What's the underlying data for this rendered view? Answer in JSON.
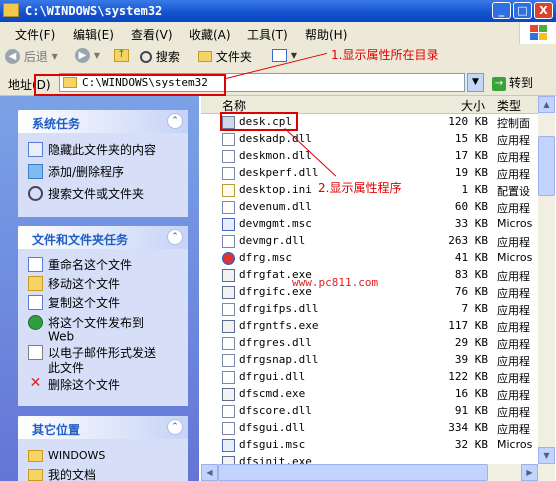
{
  "window": {
    "title": "C:\\WINDOWS\\system32",
    "min": "_",
    "max": "□",
    "close": "X"
  },
  "menu": [
    {
      "label": "文件(F)"
    },
    {
      "label": "编辑(E)"
    },
    {
      "label": "查看(V)"
    },
    {
      "label": "收藏(A)"
    },
    {
      "label": "工具(T)"
    },
    {
      "label": "帮助(H)"
    }
  ],
  "toolbar": {
    "back": "后退",
    "forward": "",
    "search": "搜索",
    "folders": "文件夹"
  },
  "address": {
    "label": "地址(D)",
    "value": "C:\\WINDOWS\\system32",
    "go": "转到"
  },
  "tasks": {
    "system": {
      "title": "系统任务",
      "items": [
        "隐藏此文件夹的内容",
        "添加/删除程序",
        "搜索文件或文件夹"
      ]
    },
    "file": {
      "title": "文件和文件夹任务",
      "items": [
        "重命名这个文件",
        "移动这个文件",
        "复制这个文件",
        "将这个文件发布到",
        "Web",
        "以电子邮件形式发送",
        "此文件",
        "删除这个文件"
      ]
    },
    "other": {
      "title": "其它位置",
      "items": [
        "WINDOWS",
        "我的文档"
      ]
    }
  },
  "columns": {
    "name": "名称",
    "size": "大小",
    "type": "类型"
  },
  "files": [
    {
      "name": "desk.cpl",
      "size": "120 KB",
      "type": "控制面",
      "icon": "cpl-icon"
    },
    {
      "name": "deskadp.dll",
      "size": "15 KB",
      "type": "应用程",
      "icon": "dll-icon"
    },
    {
      "name": "deskmon.dll",
      "size": "17 KB",
      "type": "应用程",
      "icon": "dll-icon"
    },
    {
      "name": "deskperf.dll",
      "size": "19 KB",
      "type": "应用程",
      "icon": "dll-icon"
    },
    {
      "name": "desktop.ini",
      "size": "1 KB",
      "type": "配置设",
      "icon": "ini-icon"
    },
    {
      "name": "devenum.dll",
      "size": "60 KB",
      "type": "应用程",
      "icon": "dll-icon"
    },
    {
      "name": "devmgmt.msc",
      "size": "33 KB",
      "type": "Micros",
      "icon": "msc-icon"
    },
    {
      "name": "devmgr.dll",
      "size": "263 KB",
      "type": "应用程",
      "icon": "dll-icon"
    },
    {
      "name": "dfrg.msc",
      "size": "41 KB",
      "type": "Micros",
      "icon": "dfrg-icon"
    },
    {
      "name": "dfrgfat.exe",
      "size": "83 KB",
      "type": "应用程",
      "icon": "exe-icon"
    },
    {
      "name": "dfrgifc.exe",
      "size": "76 KB",
      "type": "应用程",
      "icon": "exe-icon"
    },
    {
      "name": "dfrgifps.dll",
      "size": "7 KB",
      "type": "应用程",
      "icon": "dll-icon"
    },
    {
      "name": "dfrgntfs.exe",
      "size": "117 KB",
      "type": "应用程",
      "icon": "exe-icon"
    },
    {
      "name": "dfrgres.dll",
      "size": "29 KB",
      "type": "应用程",
      "icon": "dll-icon"
    },
    {
      "name": "dfrgsnap.dll",
      "size": "39 KB",
      "type": "应用程",
      "icon": "dll-icon"
    },
    {
      "name": "dfrgui.dll",
      "size": "122 KB",
      "type": "应用程",
      "icon": "dll-icon"
    },
    {
      "name": "dfscmd.exe",
      "size": "16 KB",
      "type": "应用程",
      "icon": "exe-icon"
    },
    {
      "name": "dfscore.dll",
      "size": "91 KB",
      "type": "应用程",
      "icon": "dll-icon"
    },
    {
      "name": "dfsgui.dll",
      "size": "334 KB",
      "type": "应用程",
      "icon": "dll-icon"
    },
    {
      "name": "dfsgui.msc",
      "size": "32 KB",
      "type": "Micros",
      "icon": "msc-icon"
    },
    {
      "name": "dfsinit.exe",
      "size": "",
      "type": "",
      "icon": "exe-icon"
    }
  ],
  "annotations": {
    "a1": "1.显示属性所在目录",
    "a2": "2.显示属性程序",
    "watermark": "www.pc811.com"
  },
  "colors": {
    "accent": "#215dc6",
    "annotation": "#e00000",
    "title_bar": "#0b46be"
  }
}
